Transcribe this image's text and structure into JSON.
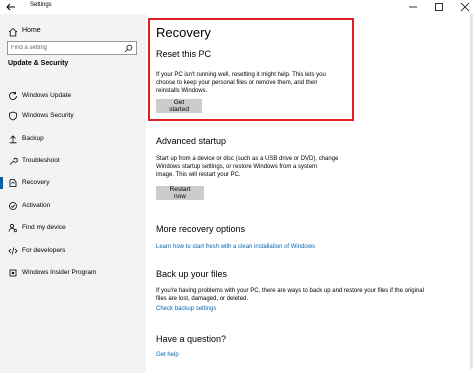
{
  "window": {
    "title": "Settings",
    "controls": [
      "minimize",
      "maximize",
      "close"
    ]
  },
  "sidebar": {
    "home_label": "Home",
    "search_placeholder": "Find a setting",
    "section_title": "Update & Security",
    "items": [
      {
        "label": "Windows Update",
        "icon": "refresh-icon"
      },
      {
        "label": "Windows Security",
        "icon": "shield-icon"
      },
      {
        "label": "Backup",
        "icon": "backup-icon"
      },
      {
        "label": "Troubleshoot",
        "icon": "wrench-icon"
      },
      {
        "label": "Recovery",
        "icon": "recovery-icon",
        "selected": true
      },
      {
        "label": "Activation",
        "icon": "activation-icon"
      },
      {
        "label": "Find my device",
        "icon": "person-locate-icon"
      },
      {
        "label": "For developers",
        "icon": "developer-icon"
      },
      {
        "label": "Windows Insider Program",
        "icon": "insider-icon"
      }
    ]
  },
  "main": {
    "page_title": "Recovery",
    "reset": {
      "heading": "Reset this PC",
      "text_lines": [
        "If your PC isn't running well, resetting it might help. This lets you",
        "choose to keep your personal files or remove them, and then",
        "reinstalls Windows."
      ],
      "button_label": "Get started"
    },
    "advanced": {
      "heading": "Advanced startup",
      "text_lines": [
        "Start up from a device or disc (such as a USB drive or DVD), change",
        "Windows startup settings, or restore Windows from a system",
        "image. This will restart your PC."
      ],
      "button_label": "Restart now"
    },
    "more": {
      "heading": "More recovery options",
      "link": "Learn how to start fresh with a clean installation of Windows"
    },
    "backup": {
      "heading": "Back up your files",
      "text_lines": [
        "If you're having problems with your PC, there are ways to back up and restore your files if the original",
        "files are lost, damaged, or deleted."
      ],
      "link": "Check backup settings"
    },
    "question": {
      "heading": "Have a question?",
      "link": "Get help"
    }
  },
  "colors": {
    "accent": "#0063b1",
    "link": "#0066b4",
    "highlight_border": "#e02020",
    "sidebar_bg": "#f3f3f3",
    "button_bg": "#cccccc"
  }
}
